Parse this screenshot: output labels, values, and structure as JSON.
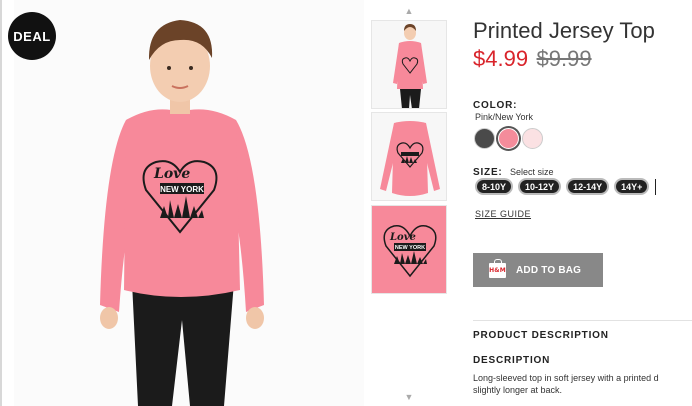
{
  "badge": {
    "label": "DEAL"
  },
  "product": {
    "title": "Printed Jersey Top",
    "price_current": "$4.99",
    "price_original": "$9.99"
  },
  "color": {
    "label": "COLOR:",
    "selected": "Pink/New York",
    "swatches": [
      {
        "name": "dark-grey",
        "hex": "#4a4a4a"
      },
      {
        "name": "pink",
        "hex": "#f48c9b",
        "selected": true
      },
      {
        "name": "light-pink",
        "hex": "#fbe1e3"
      }
    ]
  },
  "size": {
    "label": "SIZE:",
    "hint": "Select size",
    "options": [
      "8-10Y",
      "10-12Y",
      "12-14Y",
      "14Y+"
    ],
    "guide_label": "SIZE GUIDE"
  },
  "cart": {
    "add_label": "ADD TO BAG",
    "bag_logo": "H&M"
  },
  "description": {
    "section_heading": "PRODUCT DESCRIPTION",
    "heading": "DESCRIPTION",
    "lines": [
      "Long-sleeved top in soft jersey with a printed d",
      "slightly longer at back."
    ]
  },
  "print": {
    "script": "Love",
    "city": "NEW YORK"
  },
  "colors": {
    "shirt": "#f7899a",
    "pants": "#1b1b1b",
    "price_red": "#d9242b",
    "button_grey": "#888888"
  }
}
